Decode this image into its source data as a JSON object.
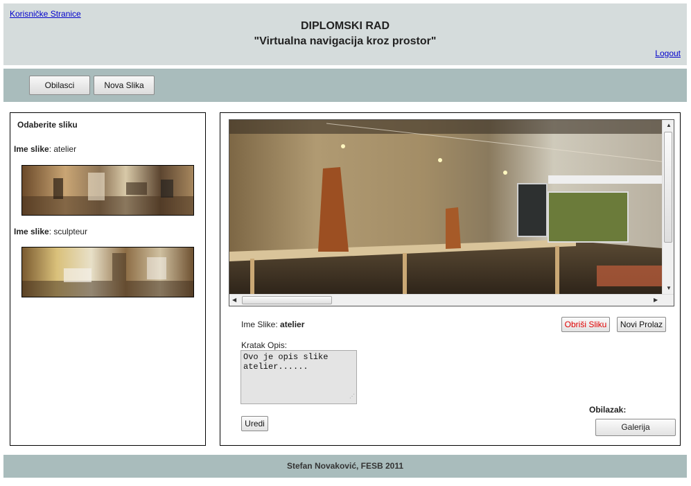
{
  "header": {
    "home_link": "Korisničke Stranice",
    "title_line1": "DIPLOMSKI RAD",
    "title_line2": "\"Virtualna navigacija kroz prostor\"",
    "logout_link": "Logout"
  },
  "navbar": {
    "tours_button": "Obilasci",
    "new_image_button": "Nova Slika"
  },
  "left_panel": {
    "title": "Odaberite sliku",
    "items": [
      {
        "label": "Ime slike",
        "value": "atelier"
      },
      {
        "label": "Ime slike",
        "value": "sculpteur"
      }
    ]
  },
  "main_panel": {
    "image_name_label": "Ime Slike:",
    "image_name_value": "atelier",
    "delete_button": "Obriši Sliku",
    "new_pass_button": "Novi Prolaz",
    "description_label": "Kratak Opis:",
    "description_value": "Ovo je opis slike atelier......",
    "edit_button": "Uredi",
    "tour_label": "Obilazak:",
    "gallery_button": "Galerija"
  },
  "footer": {
    "text": "Stefan Novaković, FESB 2011"
  },
  "colors": {
    "header_bg": "#d5dcdc",
    "nav_bg": "#a9bcbc",
    "link": "#0000cc",
    "delete_text": "#e00000"
  }
}
